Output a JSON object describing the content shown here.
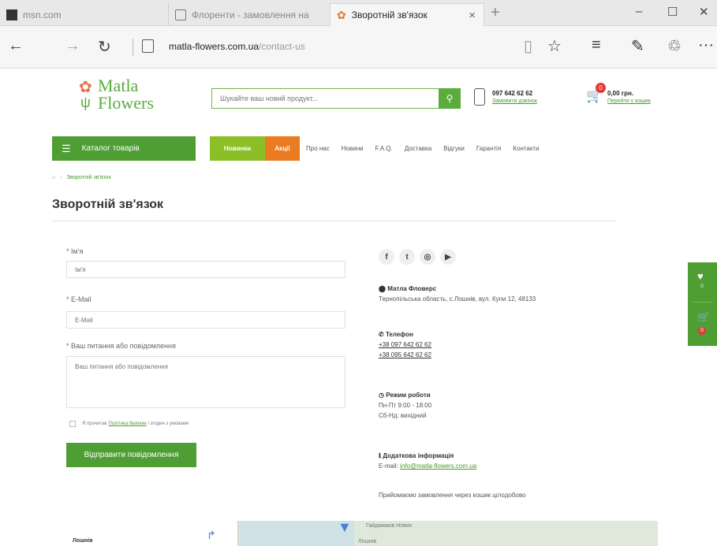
{
  "browser": {
    "tabs": [
      {
        "title": "msn.com"
      },
      {
        "title": "Флоренти - замовлення на"
      },
      {
        "title": "Зворотній зв'язок",
        "close": "×"
      }
    ],
    "new_tab": "+",
    "window": {
      "minimize": "–",
      "maximize": "☐",
      "close": "✕"
    },
    "url_host": "matla-flowers.com.ua",
    "url_path": "/contact-us",
    "nav": {
      "back": "←",
      "forward": "→",
      "refresh": "↻"
    },
    "tools": {
      "reading": "▯",
      "favorite": "☆",
      "hub": "≡",
      "note": "✎",
      "share": "♲",
      "more": "···"
    }
  },
  "site": {
    "logo": {
      "line1": "Matla",
      "line2": "Flowers"
    },
    "search_placeholder": "Шукайте ваш новий продукт...",
    "search_icon": "⚲",
    "phone": "097 642 62 62",
    "phone_sub": "Замовити дзвінок",
    "cart_count": "0",
    "cart_total": "0,00 грн.",
    "cart_sub": "Перейти у кошик",
    "accent_color": "#4e9e34"
  },
  "menu": {
    "catalog": "Каталог товарів",
    "new": "Новинки",
    "sale": "Акції",
    "links": [
      "Про нас",
      "Новини",
      "F.A.Q.",
      "Доставка",
      "Відгуки",
      "Гарантія",
      "Контакти"
    ]
  },
  "breadcrumb": {
    "current": "Зворотній зв'язок"
  },
  "page_title": "Зворотній зв'язок",
  "form": {
    "name_label": "Ім'я",
    "name_placeholder": "Ім'я",
    "email_label": "E-Mail",
    "email_placeholder": "E-Mail",
    "message_label": "Ваш питання або повідомлення",
    "message_placeholder": "Ваш питання або повідомлення",
    "required_mark": "*",
    "agree_before": "Я прочитав",
    "agree_link": "Політика безпеки",
    "agree_after": "і згоден з умовами",
    "submit": "Відправити повідомлення"
  },
  "contacts": {
    "social": [
      "f",
      "t",
      "◎",
      "▶"
    ],
    "store_title": "Матла Фловерс",
    "store_address": "Тернопільська область, с.Лошнів, вул. Купи 12, 48133",
    "phone_title": "Телефон",
    "phones": [
      "+38 097 642 62 62",
      "+38 095 642 62 62"
    ],
    "hours_title": "Режим роботи",
    "hours": [
      "Пн-Пт 9:00 - 18:00",
      "Сб-Нд: вихідний"
    ],
    "extra_title": "Додаткова інформація",
    "email_label": "E-mail:",
    "email": "info@matla-flowers.com.ua",
    "note": "Прийомаємо замовлення через кошик цілодобово"
  },
  "side_widget": {
    "wishlist_count": "0",
    "cart_count": "0"
  },
  "map": {
    "card_title": "Лошнів",
    "label1": "Гайдамаків Нових",
    "label2": "Лошнів"
  }
}
